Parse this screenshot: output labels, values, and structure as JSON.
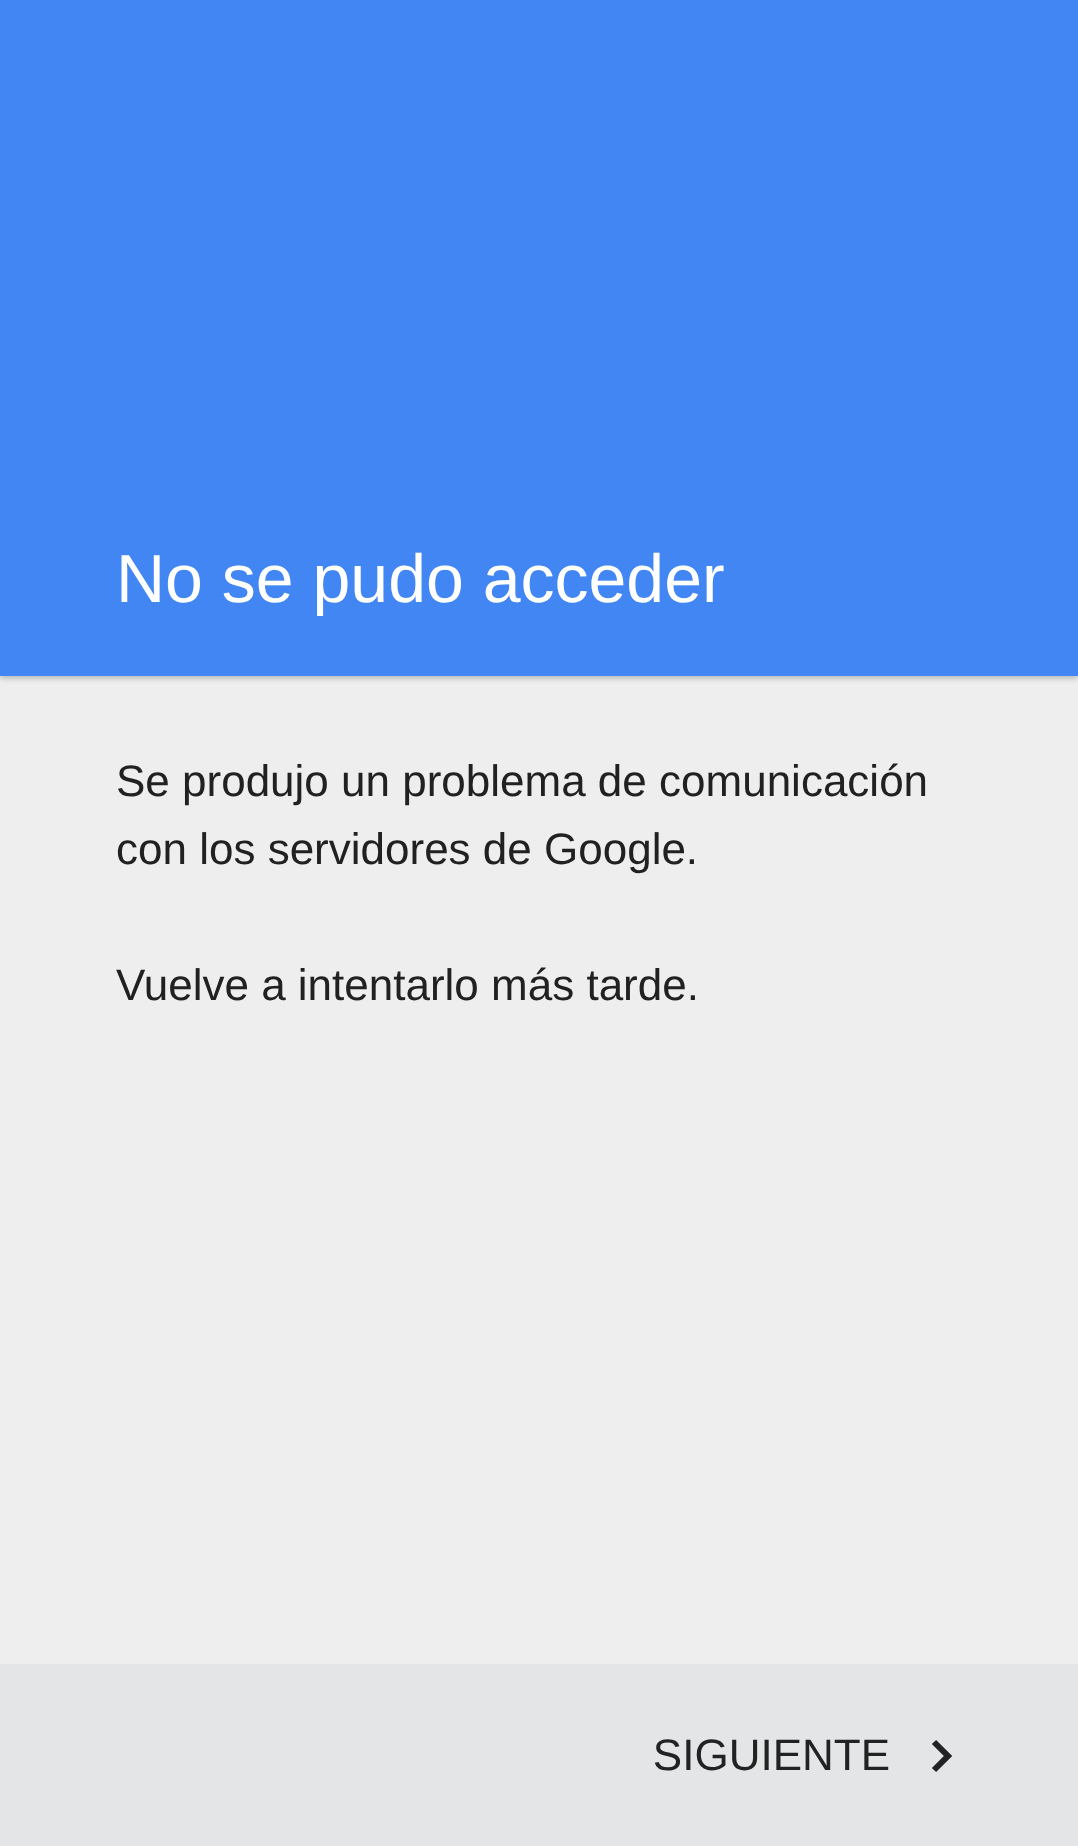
{
  "header": {
    "title": "No se pudo acceder"
  },
  "body": {
    "paragraphs": [
      "Se produjo un problema de comunicación con los servidores de Google.",
      "Vuelve a intentarlo más tarde."
    ]
  },
  "footer": {
    "next_button": {
      "label": "SIGUIENTE"
    }
  }
}
